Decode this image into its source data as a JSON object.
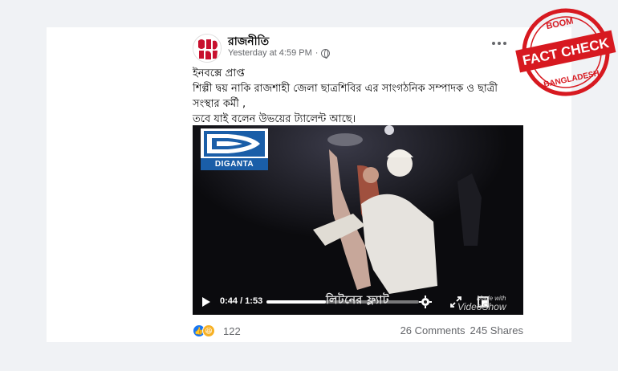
{
  "post": {
    "page_name": "রাজনীতি",
    "timestamp": "Yesterday at 4:59 PM",
    "separator": "·",
    "avatar_icon": "page-logo-icon",
    "privacy_icon": "globe-icon",
    "more_icon": "more-options-icon",
    "text_lines": [
      "ইনবক্সে প্রাপ্ত",
      "শিল্পী দ্বয় নাকি রাজশাহী জেলা ছাত্রশিবির এর সাংগঠনিক সম্পাদক ও ছাত্রী",
      "সংস্থার কর্মী ,",
      "তবে যাই বলেন উভয়ের ট্যালেন্ট আছে।"
    ]
  },
  "video": {
    "logo_text": "DIGANTA",
    "current_time": "0:44",
    "duration": "1:53",
    "time_display": "0:44 / 1:53",
    "progress": 0.39,
    "caption": "লিটনের ফ্ল্যাট",
    "watermark_small": "Made with",
    "watermark": "VideoShow",
    "icons": [
      "play-icon",
      "settings-icon",
      "fullscreen-icon",
      "volume-icon"
    ]
  },
  "footer": {
    "reaction_count": "122",
    "comments": "26 Comments",
    "shares": "245 Shares",
    "reaction_icons": [
      "like-icon",
      "haha-icon"
    ]
  },
  "badge": {
    "top_text": "BOOM",
    "main_text": "FACT CHECK",
    "bottom_text": "BANGLADESH",
    "color": "#d71920"
  }
}
